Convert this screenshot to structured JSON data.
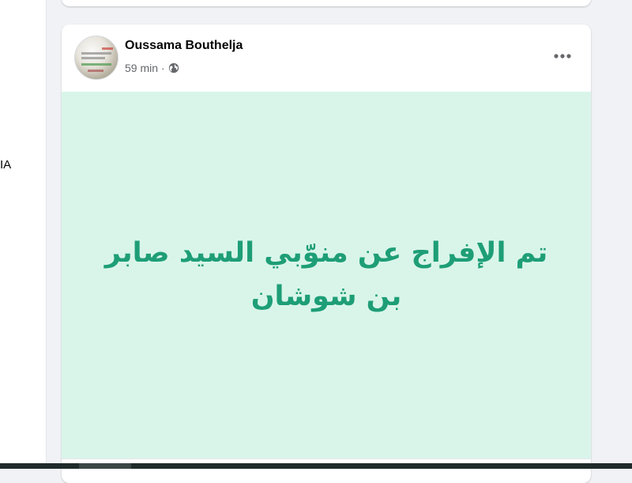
{
  "left_panel": {
    "partial_text": "IA"
  },
  "post": {
    "author": "Oussama Bouthelja",
    "timestamp": "59 min",
    "separator": "·",
    "privacy_icon": "globe-icon",
    "more_icon": "more-options-icon",
    "content_text": "تم الإفراج عن منوّبي السيد صابر بن شوشان",
    "background_color": "#d9f5ea",
    "text_color": "#1e9e76"
  }
}
